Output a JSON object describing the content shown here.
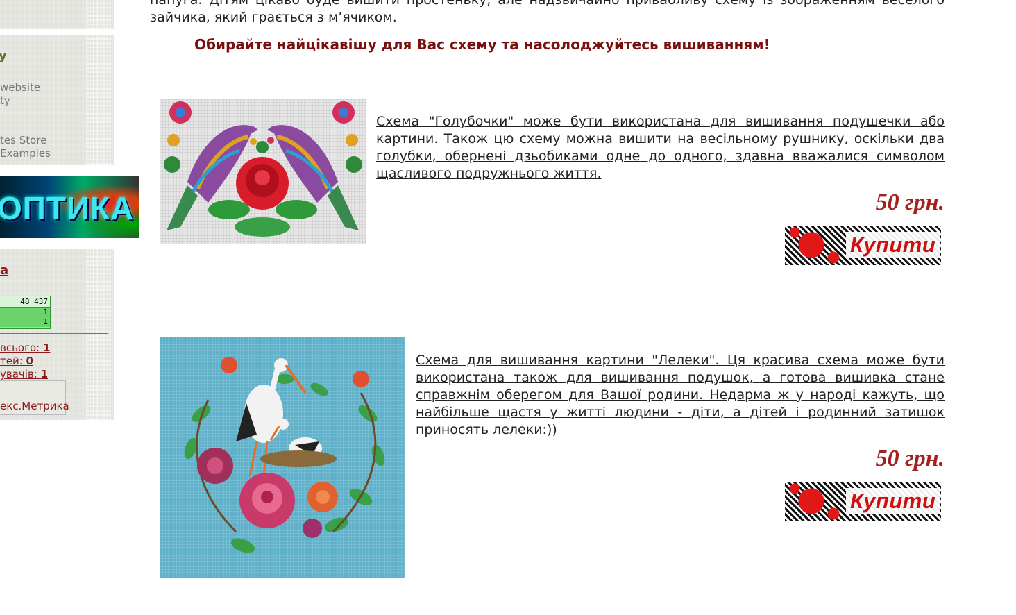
{
  "sidebar": {
    "block2": {
      "heading": "y",
      "links": [
        "website",
        "ty",
        "tes Store",
        "Examples"
      ]
    },
    "banner": {
      "text": "ОПТИКА"
    },
    "stats_block": {
      "heading": "a",
      "counter": {
        "row1": "48 437",
        "row2": "1",
        "row3": "1"
      },
      "lines": [
        {
          "label": "всього: ",
          "value": "1"
        },
        {
          "label": "тей: ",
          "value": "0"
        },
        {
          "label": "увачів: ",
          "value": "1"
        }
      ],
      "metrika": "екс.Метрика"
    }
  },
  "main": {
    "intro_text": "папуга. Дітям цікаво буде вишити простеньку, але надзвичайно привабливу схему із зображенням веселого зайчика, який грається з м’ячиком.",
    "headline": "Обирайте найцікавішу для Вас схему та насолоджуйтесь вишиванням!",
    "products": [
      {
        "description": "Схема \"Голубочки\" може бути використана для вишивання подушечки або картини. Також цю схему можна вишити на весільному рушнику, оскільки два голубки, обернені дзьобиками одне до одного, здавна вважалися символом щасливого подружнього життя.",
        "price": "50 грн.",
        "buy_label": "Купити"
      },
      {
        "description": "Схема для вишивання картини \"Лелеки\". Ця красива схема може бути використана також для вишивання подушок, а готова вишивка стане справжнім оберегом для Вашої родини. Недарма ж у народі кажуть, що найбільше щастя у житті людини - діти, а дітей і родинний затишок приносять лелеки:))",
        "price": "50 грн.",
        "buy_label": "Купити"
      }
    ]
  }
}
